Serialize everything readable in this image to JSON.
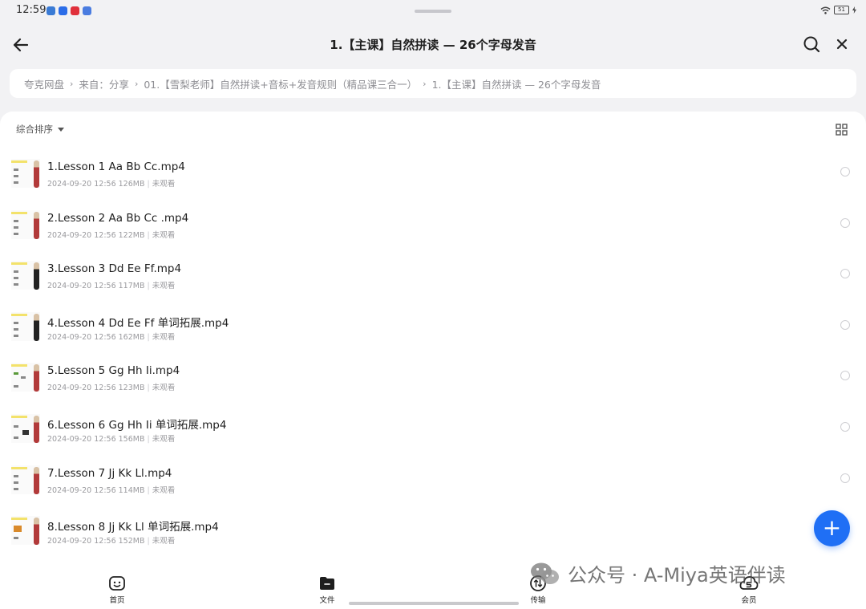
{
  "status_bar": {
    "time": "12:59",
    "battery": "51"
  },
  "header": {
    "title": "1.【主课】自然拼读 — 26个字母发音"
  },
  "breadcrumb": [
    "夸克网盘",
    "来自：分享",
    "01.【雪梨老师】自然拼读+音标+发音规则（精品课三合一）",
    "1.【主课】自然拼读 — 26个字母发音"
  ],
  "sort": {
    "label": "综合排序"
  },
  "files": [
    {
      "name": "1.Lesson 1 Aa Bb Cc.mp4",
      "date": "2024-09-20 12:56",
      "size": "126MB",
      "status": "未观看"
    },
    {
      "name": "2.Lesson 2 Aa Bb Cc .mp4",
      "date": "2024-09-20 12:56",
      "size": "122MB",
      "status": "未观看"
    },
    {
      "name": "3.Lesson 3 Dd Ee Ff.mp4",
      "date": "2024-09-20 12:56",
      "size": "117MB",
      "status": "未观看"
    },
    {
      "name": "4.Lesson 4 Dd Ee Ff 单词拓展.mp4",
      "date": "2024-09-20 12:56",
      "size": "162MB",
      "status": "未观看"
    },
    {
      "name": "5.Lesson 5 Gg Hh Ii.mp4",
      "date": "2024-09-20 12:56",
      "size": "123MB",
      "status": "未观看"
    },
    {
      "name": "6.Lesson 6 Gg Hh Ii 单词拓展.mp4",
      "date": "2024-09-20 12:56",
      "size": "156MB",
      "status": "未观看"
    },
    {
      "name": "7.Lesson 7 Jj Kk Ll.mp4",
      "date": "2024-09-20 12:56",
      "size": "114MB",
      "status": "未观看"
    },
    {
      "name": "8.Lesson 8 Jj Kk Ll 单词拓展.mp4",
      "date": "2024-09-20 12:56",
      "size": "152MB",
      "status": "未观看"
    }
  ],
  "fab": {
    "label": "+"
  },
  "watermark": {
    "text": "公众号 · A-Miya英语伴读"
  },
  "bottom_nav": {
    "home": "首页",
    "files": "文件",
    "transfer": "传输",
    "vip": "会员"
  },
  "colors": {
    "accent": "#1f6ff5",
    "background": "#f2f2f4"
  }
}
